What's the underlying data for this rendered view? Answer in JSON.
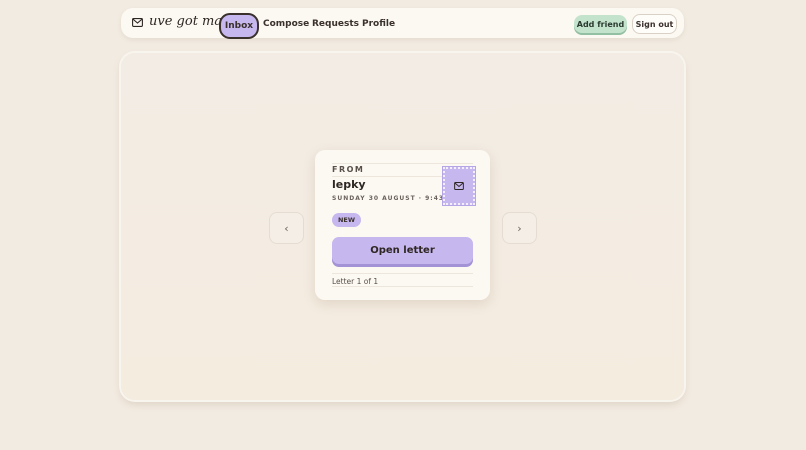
{
  "nav": {
    "brand": "uve got mail!",
    "tabs": [
      {
        "label": "Inbox",
        "active": true
      },
      {
        "label": "Compose",
        "active": false
      },
      {
        "label": "Requests",
        "active": false
      },
      {
        "label": "Profile",
        "active": false
      }
    ],
    "add_friend": "Add friend",
    "sign_out": "Sign out"
  },
  "letter": {
    "from_label": "FROM",
    "sender": "lepky",
    "date": "SUNDAY 30 AUGUST · 9:43",
    "badge": "NEW",
    "open_button": "Open letter",
    "count": "Letter 1 of 1"
  },
  "carousel": {
    "prev": "‹",
    "next": "›"
  },
  "colors": {
    "background": "#f2ebe1",
    "accent_lavender": "#c6b7ef",
    "accent_green": "#c4e3cd",
    "text_dark": "#3a302c"
  }
}
